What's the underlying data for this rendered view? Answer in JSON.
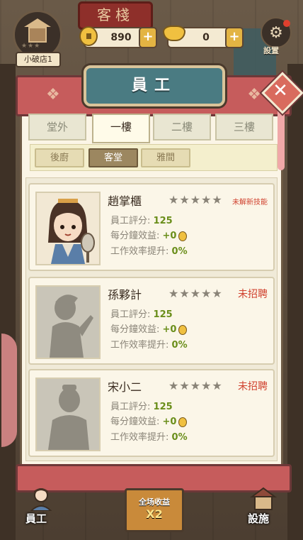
{
  "hud": {
    "sign_text": "客棧",
    "shop_name": "小破店1",
    "shop_stars": "★★★",
    "copper_coins": "890",
    "gold_ingots": "0",
    "plus": "+",
    "settings_label": "設置"
  },
  "panel": {
    "title": "員工",
    "close": "✕",
    "floor_tabs": [
      "堂外",
      "一樓",
      "二樓",
      "三樓"
    ],
    "active_floor": "一樓",
    "room_tabs": [
      "後廚",
      "客堂",
      "雅間"
    ],
    "active_room": "客堂"
  },
  "labels": {
    "rating": "員工評分:",
    "income": "每分鐘效益:",
    "efficiency": "工作效率提升:"
  },
  "staff": [
    {
      "name": "趙掌櫃",
      "stars": "★★★★★",
      "status": "未解新技能",
      "rating": "125",
      "income": "+0",
      "efficiency": "0%"
    },
    {
      "name": "孫夥計",
      "stars": "★★★★★",
      "status": "未招聘",
      "rating": "125",
      "income": "+0",
      "efficiency": "0%"
    },
    {
      "name": "宋小二",
      "stars": "★★★★★",
      "status": "未招聘",
      "rating": "125",
      "income": "+0",
      "efficiency": "0%"
    }
  ],
  "bottom_nav": {
    "staff": "員工",
    "boost_title": "全场收益",
    "boost_mult": "X2",
    "facility": "設施"
  },
  "colors": {
    "panel_red": "#c65c5c",
    "plaque_teal": "#4a7b82",
    "status_red": "#d0412e",
    "value_green": "#6a8e1a"
  }
}
